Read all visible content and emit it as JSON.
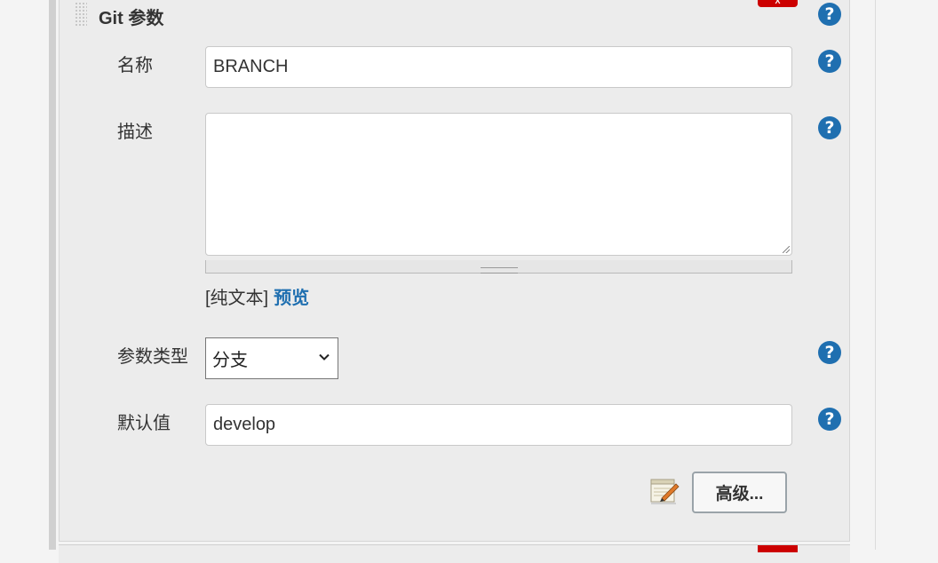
{
  "section": {
    "title": "Git 参数",
    "delete_label": "X"
  },
  "fields": {
    "name": {
      "label": "名称",
      "value": "BRANCH"
    },
    "description": {
      "label": "描述",
      "value": ""
    },
    "format": {
      "plain_text": "[纯文本]",
      "preview": "预览"
    },
    "param_type": {
      "label": "参数类型",
      "selected": "分支"
    },
    "default_value": {
      "label": "默认值",
      "value": "develop"
    }
  },
  "help_glyph": "?",
  "advanced_button": "高级...",
  "icons": [
    "help-icon",
    "notepad-icon",
    "chevron-down-icon",
    "drag-handle-icon"
  ],
  "colors": {
    "help_blue": "#1f6fb0",
    "delete_red": "#cc0000",
    "panel_bg": "#ececec"
  }
}
